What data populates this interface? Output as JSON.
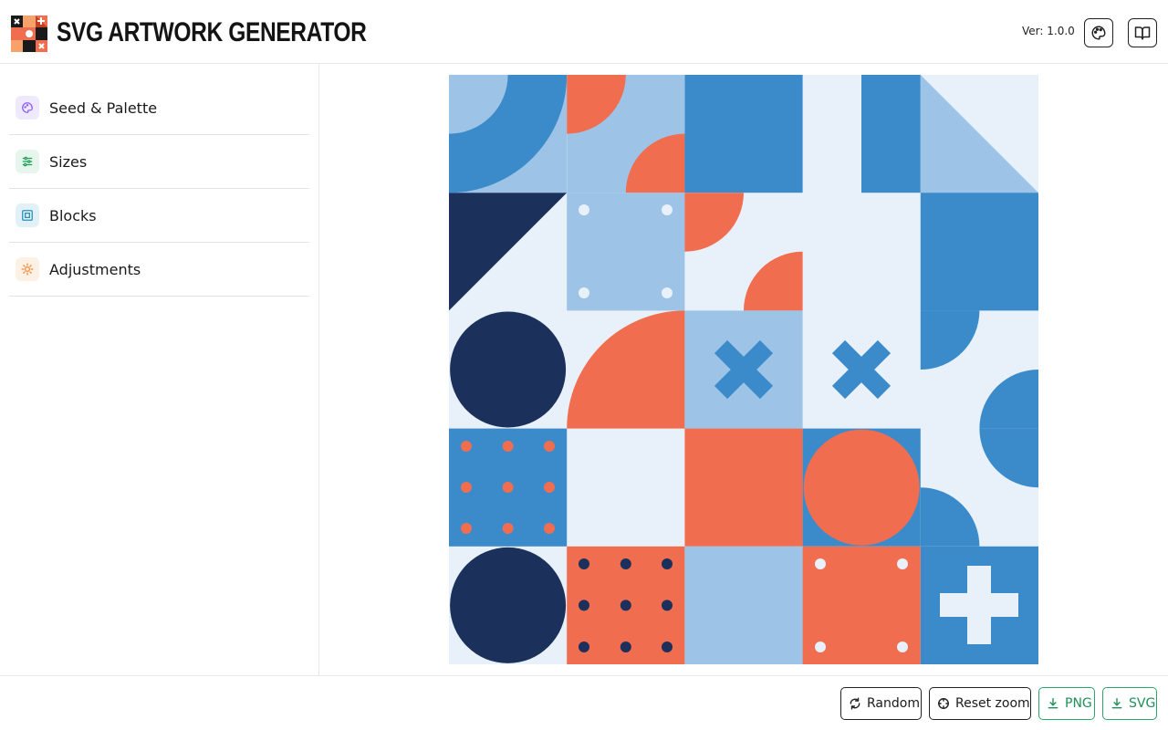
{
  "header": {
    "title": "SVG ARTWORK GENERATOR",
    "version": "Ver: 1.0.0",
    "palette_button_icon": "palette-icon",
    "docs_button_icon": "book-icon"
  },
  "sidebar": {
    "items": [
      {
        "label": "Seed & Palette",
        "icon": "palette-icon",
        "icon_color": "#8b5cf6",
        "icon_bg": "#efe9fc"
      },
      {
        "label": "Sizes",
        "icon": "sliders-icon",
        "icon_color": "#22a05a",
        "icon_bg": "#e6f6ec"
      },
      {
        "label": "Blocks",
        "icon": "blocks-icon",
        "icon_color": "#2a8fb8",
        "icon_bg": "#e2f1f8"
      },
      {
        "label": "Adjustments",
        "icon": "adjust-icon",
        "icon_color": "#f08a3c",
        "icon_bg": "#fdf0e4"
      }
    ]
  },
  "artwork": {
    "grid": 5,
    "palette": {
      "background": "#e8f1f9",
      "light_blue": "#9dc3e6",
      "blue": "#3b8bcb",
      "navy": "#1c305c",
      "orange": "#f16d50"
    },
    "blocks": [
      [
        "quarter-rings",
        "quarter-circles-orange",
        "blue-square",
        "blue-bar",
        "light-triangle"
      ],
      [
        "navy-triangle",
        "dots-light",
        "quarter-circles-orange-light",
        "empty",
        "blue-square"
      ],
      [
        "navy-circle",
        "orange-quarter",
        "blue-x-on-light",
        "blue-x",
        "half-circles-blue"
      ],
      [
        "orange-dots-on-blue",
        "empty",
        "orange-square",
        "orange-circle-on-blue",
        "half-circles-blue-2"
      ],
      [
        "navy-circle",
        "navy-dots-on-orange",
        "light-blue-square",
        "white-dots-on-orange",
        "plus-on-blue"
      ]
    ]
  },
  "footer": {
    "random_label": "Random",
    "reset_label": "Reset zoom",
    "png_label": "PNG",
    "svg_label": "SVG"
  },
  "colors": {
    "accent_green": "#1e8f58",
    "border_dark": "#222222"
  }
}
